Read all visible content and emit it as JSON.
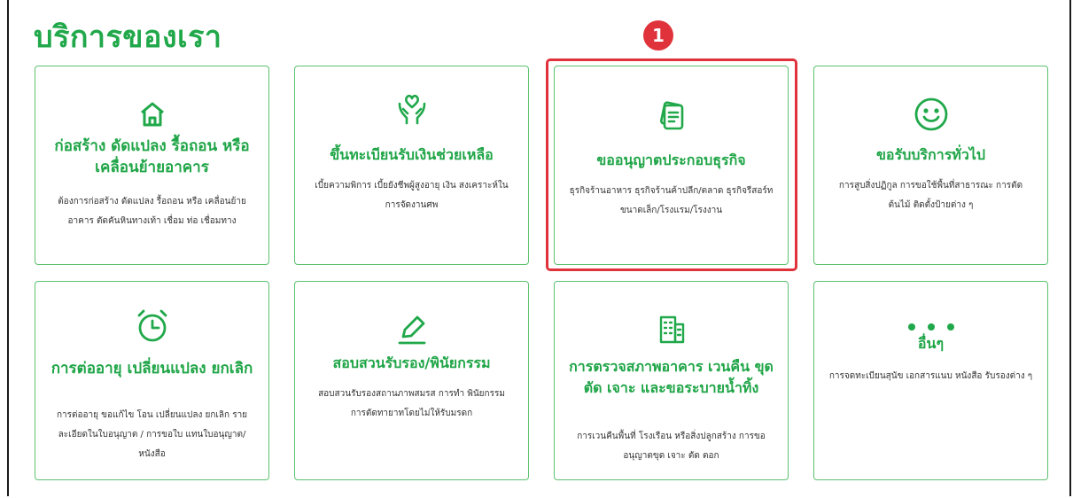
{
  "page": {
    "heading": "บริการของเรา"
  },
  "annotation": {
    "badge_number": "1",
    "accent": "#e0323b"
  },
  "brand_color": "#20a84a",
  "services": [
    {
      "icon": "home-icon",
      "title": "ก่อสร้าง ดัดแปลง รื้อถอน หรือเคลื่อนย้ายอาคาร",
      "description": "ต้องการก่อสร้าง ดัดแปลง รื้อถอน หรือ เคลื่อนย้ายอาคาร ตัดคันหินทางเท้า เชื่อม ท่อ เชื่อมทาง"
    },
    {
      "icon": "heart-hands-icon",
      "title": "ขึ้นทะเบียนรับเงินช่วยเหลือ",
      "description": "เบี้ยความพิการ เบี้ยยังชีพผู้สูงอายุ เงิน สงเคราะห์ในการจัดงานศพ"
    },
    {
      "icon": "document-stack-icon",
      "title": "ขออนุญาตประกอบธุรกิจ",
      "description": "ธุรกิจร้านอาหาร ธุรกิจร้านค้าปลีก/ตลาด ธุรกิจรีสอร์ทขนาดเล็ก/โรงแรม/โรงงาน"
    },
    {
      "icon": "smiley-icon",
      "title": "ขอรับบริการทั่วไป",
      "description": "การสูบสิ่งปฏิกูล การขอใช้พื้นที่สาธารณะ การตัดต้นไม้ ติดตั้งป้ายต่าง ๆ"
    },
    {
      "icon": "alarm-clock-icon",
      "title": "การต่ออายุ เปลี่ยนแปลง ยกเลิก",
      "description": "การต่ออายุ ขอแก้ไข โอน เปลี่ยนแปลง ยกเลิก รายละเอียดในใบอนุญาต / การขอใบ แทนใบอนุญาต/หนังสือ"
    },
    {
      "icon": "pencil-icon",
      "title": "สอบสวนรับรอง/พินัยกรรม",
      "description": "สอบสวนรับรองสถานภาพสมรส การทำ พินัยกรรม การตัดทายาทโดยไม่ให้รับมรดก"
    },
    {
      "icon": "building-icon",
      "title": "การตรวจสภาพอาคาร เวนคืน ขุด ตัด เจาะ และขอระบายน้ำทิ้ง",
      "description": "การเวนคืนพื้นที่ โรงเรือน หรือสิ่งปลูกสร้าง การขออนุญาตขุด เจาะ ตัด ตอก"
    },
    {
      "icon": "more-dots-icon",
      "title": "อื่นๆ",
      "description": "การจดทะเบียนสุนัข เอกสารแนบ หนังสือ รับรองต่าง ๆ"
    }
  ]
}
